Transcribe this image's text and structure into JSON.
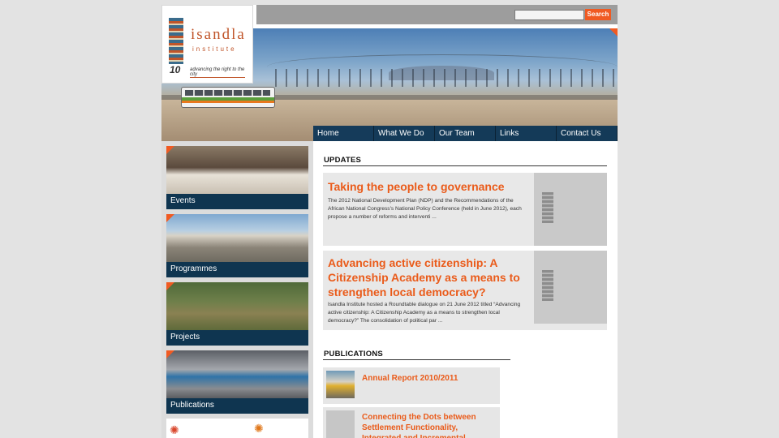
{
  "brand": {
    "name": "isandla",
    "subname": "institute",
    "anniversary": "10",
    "tagline": "advancing the right to the city"
  },
  "search": {
    "placeholder": "",
    "button_label": "Search"
  },
  "nav": {
    "items": [
      {
        "label": "Home"
      },
      {
        "label": "What We Do"
      },
      {
        "label": "Our Team"
      },
      {
        "label": "Links"
      },
      {
        "label": "Contact Us"
      }
    ]
  },
  "sidebar": {
    "tiles": [
      {
        "label": "Events"
      },
      {
        "label": "Programmes"
      },
      {
        "label": "Projects"
      },
      {
        "label": "Publications"
      }
    ]
  },
  "updates": {
    "heading": "UPDATES",
    "items": [
      {
        "title": "Taking the people to governance",
        "excerpt": "The 2012 National Development Plan (NDP) and the Recommendations of the African National Congress's National Policy Conference (held in June 2012), each propose a number of reforms and interventi ..."
      },
      {
        "title": "Advancing active citizenship: A Citizenship Academy as a means to strengthen local democracy?",
        "excerpt": "Isandla Institute hosted a Roundtable dialogue on 21 June 2012 titled “Advancing active citizenship: A Citizenship Academy as a means to strengthen local democracy?” The consolidation of political par ..."
      }
    ]
  },
  "publications": {
    "heading": "PUBLICATIONS",
    "items": [
      {
        "title": "Annual Report 2010/2011"
      },
      {
        "title": "Connecting the Dots between Settlement Functionality, Integrated and Incremental Upgrading and the"
      }
    ]
  },
  "colors": {
    "accent": "#f05a22",
    "nav_bg": "#143a58",
    "link_orange": "#ea5b1a",
    "page_bg": "#e3e3e3"
  }
}
